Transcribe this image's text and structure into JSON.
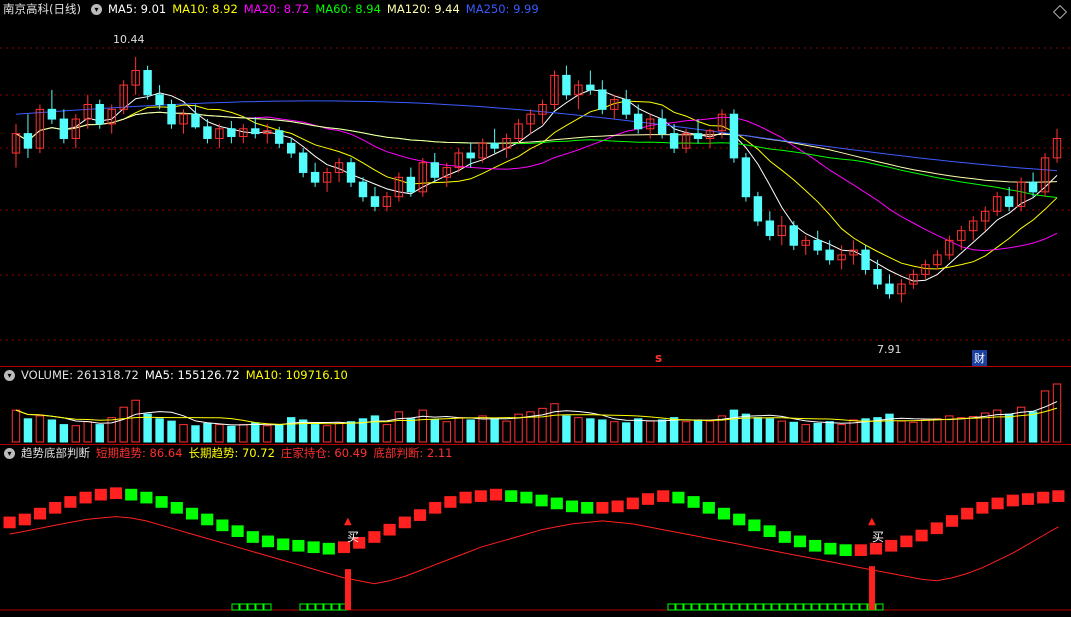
{
  "price_header": {
    "stock": "南京高科(日线)",
    "ma5": "MA5: 9.01",
    "ma10": "MA10: 8.92",
    "ma20": "MA20: 8.72",
    "ma60": "MA60: 8.94",
    "ma120": "MA120: 9.44",
    "ma250": "MA250: 9.99"
  },
  "price_annotations": {
    "high": "10.44",
    "low": "7.91",
    "marker_s": "s",
    "marker_cai": "财"
  },
  "volume_header": {
    "volume": "VOLUME: 261318.72",
    "ma5": "MA5: 155126.72",
    "ma10": "MA10: 109716.10"
  },
  "indicator_header": {
    "name": "趋势底部判断",
    "short": "短期趋势: 86.64",
    "long": "长期趋势: 70.72",
    "holding": "庄家持仓: 60.49",
    "bottom": "底部判断: 2.11"
  },
  "buy_signals": [
    {
      "label": "买"
    },
    {
      "label": "买"
    }
  ],
  "colors": {
    "bg": "#000000",
    "up": "#ff3232",
    "down": "#54fcfc",
    "ma5": "#ffffff",
    "ma10": "#ffff00",
    "ma20": "#ff00ff",
    "ma60": "#00ff00",
    "ma120": "#ffffb0",
    "ma250": "#3b5bff",
    "grid": "#8b0000",
    "ind_red": "#ff2020",
    "ind_green": "#00ff00"
  },
  "chart_data": {
    "type": "candlestick",
    "price_range": [
      7.4,
      10.8
    ],
    "candles": [
      [
        9.45,
        9.75,
        9.3,
        9.65
      ],
      [
        9.65,
        9.85,
        9.4,
        9.5
      ],
      [
        9.5,
        9.95,
        9.45,
        9.9
      ],
      [
        9.9,
        10.1,
        9.75,
        9.8
      ],
      [
        9.8,
        9.9,
        9.55,
        9.6
      ],
      [
        9.6,
        9.85,
        9.5,
        9.8
      ],
      [
        9.8,
        10.05,
        9.7,
        9.95
      ],
      [
        9.95,
        10.0,
        9.7,
        9.75
      ],
      [
        9.75,
        9.95,
        9.65,
        9.9
      ],
      [
        9.9,
        10.2,
        9.85,
        10.15
      ],
      [
        10.15,
        10.44,
        10.05,
        10.3
      ],
      [
        10.3,
        10.35,
        10.0,
        10.05
      ],
      [
        10.05,
        10.15,
        9.9,
        9.95
      ],
      [
        9.95,
        10.0,
        9.7,
        9.75
      ],
      [
        9.75,
        9.9,
        9.65,
        9.85
      ],
      [
        9.85,
        9.95,
        9.7,
        9.72
      ],
      [
        9.72,
        9.8,
        9.55,
        9.6
      ],
      [
        9.6,
        9.75,
        9.5,
        9.7
      ],
      [
        9.7,
        9.78,
        9.55,
        9.62
      ],
      [
        9.62,
        9.75,
        9.55,
        9.7
      ],
      [
        9.7,
        9.82,
        9.6,
        9.65
      ],
      [
        9.65,
        9.75,
        9.55,
        9.68
      ],
      [
        9.68,
        9.72,
        9.5,
        9.55
      ],
      [
        9.55,
        9.6,
        9.4,
        9.45
      ],
      [
        9.45,
        9.5,
        9.2,
        9.25
      ],
      [
        9.25,
        9.35,
        9.1,
        9.15
      ],
      [
        9.15,
        9.3,
        9.05,
        9.25
      ],
      [
        9.25,
        9.4,
        9.15,
        9.35
      ],
      [
        9.35,
        9.4,
        9.1,
        9.15
      ],
      [
        9.15,
        9.2,
        8.95,
        9.0
      ],
      [
        9.0,
        9.1,
        8.85,
        8.9
      ],
      [
        8.9,
        9.05,
        8.85,
        9.0
      ],
      [
        9.0,
        9.25,
        8.95,
        9.2
      ],
      [
        9.2,
        9.3,
        9.0,
        9.05
      ],
      [
        9.05,
        9.4,
        9.0,
        9.35
      ],
      [
        9.35,
        9.45,
        9.15,
        9.2
      ],
      [
        9.2,
        9.35,
        9.1,
        9.3
      ],
      [
        9.3,
        9.5,
        9.25,
        9.45
      ],
      [
        9.45,
        9.55,
        9.3,
        9.4
      ],
      [
        9.4,
        9.6,
        9.35,
        9.55
      ],
      [
        9.55,
        9.7,
        9.45,
        9.5
      ],
      [
        9.5,
        9.65,
        9.4,
        9.6
      ],
      [
        9.6,
        9.8,
        9.55,
        9.75
      ],
      [
        9.75,
        9.9,
        9.65,
        9.85
      ],
      [
        9.85,
        10.0,
        9.75,
        9.95
      ],
      [
        9.95,
        10.3,
        9.9,
        10.25
      ],
      [
        10.25,
        10.35,
        10.0,
        10.05
      ],
      [
        10.05,
        10.2,
        9.9,
        10.15
      ],
      [
        10.15,
        10.3,
        10.05,
        10.1
      ],
      [
        10.1,
        10.2,
        9.85,
        9.9
      ],
      [
        9.9,
        10.05,
        9.8,
        10.0
      ],
      [
        10.0,
        10.1,
        9.8,
        9.85
      ],
      [
        9.85,
        9.95,
        9.65,
        9.7
      ],
      [
        9.7,
        9.85,
        9.6,
        9.8
      ],
      [
        9.8,
        9.9,
        9.6,
        9.65
      ],
      [
        9.65,
        9.75,
        9.45,
        9.5
      ],
      [
        9.5,
        9.7,
        9.45,
        9.65
      ],
      [
        9.65,
        9.8,
        9.55,
        9.6
      ],
      [
        9.6,
        9.7,
        9.5,
        9.68
      ],
      [
        9.68,
        9.9,
        9.6,
        9.85
      ],
      [
        9.85,
        9.9,
        9.35,
        9.4
      ],
      [
        9.4,
        9.45,
        8.95,
        9.0
      ],
      [
        9.0,
        9.05,
        8.7,
        8.75
      ],
      [
        8.75,
        8.85,
        8.55,
        8.6
      ],
      [
        8.6,
        8.8,
        8.5,
        8.7
      ],
      [
        8.7,
        8.75,
        8.45,
        8.5
      ],
      [
        8.5,
        8.6,
        8.4,
        8.55
      ],
      [
        8.55,
        8.65,
        8.4,
        8.45
      ],
      [
        8.45,
        8.55,
        8.3,
        8.35
      ],
      [
        8.35,
        8.5,
        8.25,
        8.4
      ],
      [
        8.4,
        8.55,
        8.3,
        8.45
      ],
      [
        8.45,
        8.5,
        8.2,
        8.25
      ],
      [
        8.25,
        8.35,
        8.05,
        8.1
      ],
      [
        8.1,
        8.2,
        7.95,
        8.0
      ],
      [
        8.0,
        8.15,
        7.91,
        8.1
      ],
      [
        8.1,
        8.25,
        8.05,
        8.2
      ],
      [
        8.2,
        8.35,
        8.15,
        8.3
      ],
      [
        8.3,
        8.45,
        8.25,
        8.4
      ],
      [
        8.4,
        8.6,
        8.35,
        8.55
      ],
      [
        8.55,
        8.7,
        8.45,
        8.65
      ],
      [
        8.65,
        8.8,
        8.55,
        8.75
      ],
      [
        8.75,
        8.9,
        8.65,
        8.85
      ],
      [
        8.85,
        9.05,
        8.8,
        9.0
      ],
      [
        9.0,
        9.1,
        8.85,
        8.9
      ],
      [
        8.9,
        9.2,
        8.85,
        9.15
      ],
      [
        9.15,
        9.25,
        9.0,
        9.05
      ],
      [
        9.05,
        9.45,
        9.0,
        9.4
      ],
      [
        9.4,
        9.7,
        9.35,
        9.6
      ]
    ],
    "volumes": [
      55,
      40,
      45,
      38,
      30,
      28,
      35,
      30,
      42,
      60,
      72,
      48,
      40,
      36,
      30,
      28,
      32,
      30,
      27,
      30,
      33,
      28,
      30,
      42,
      38,
      30,
      28,
      32,
      35,
      40,
      45,
      30,
      52,
      40,
      55,
      38,
      35,
      42,
      38,
      45,
      40,
      36,
      48,
      52,
      58,
      66,
      45,
      42,
      40,
      38,
      35,
      33,
      40,
      36,
      38,
      42,
      35,
      38,
      36,
      45,
      55,
      48,
      42,
      40,
      36,
      34,
      30,
      32,
      35,
      30,
      38,
      40,
      42,
      48,
      36,
      34,
      38,
      40,
      45,
      42,
      44,
      50,
      55,
      48,
      60,
      52,
      88,
      100
    ],
    "indicator_short_trend": [
      60,
      62,
      66,
      70,
      74,
      77,
      79,
      80,
      79,
      77,
      74,
      70,
      66,
      62,
      58,
      54,
      50,
      47,
      45,
      44,
      43,
      42,
      43,
      46,
      50,
      55,
      60,
      65,
      70,
      74,
      77,
      78,
      79,
      78,
      77,
      75,
      73,
      71,
      70,
      70,
      71,
      73,
      76,
      78,
      77,
      74,
      70,
      66,
      62,
      58,
      54,
      50,
      47,
      44,
      42,
      41,
      41,
      42,
      44,
      47,
      51,
      56,
      61,
      66,
      70,
      73,
      75,
      76,
      77,
      78
    ],
    "indicator_long_trend": [
      52,
      54,
      56,
      58,
      60,
      62,
      63,
      64,
      63,
      61,
      58,
      55,
      52,
      49,
      46,
      43,
      40,
      37,
      34,
      31,
      28,
      25,
      22,
      20,
      18,
      20,
      23,
      27,
      31,
      35,
      39,
      43,
      46,
      49,
      52,
      55,
      57,
      59,
      60,
      61,
      60,
      59,
      57,
      55,
      53,
      51,
      49,
      47,
      45,
      43,
      41,
      39,
      37,
      35,
      33,
      31,
      29,
      27,
      25,
      23,
      21,
      20,
      22,
      25,
      29,
      34,
      39,
      45,
      51,
      57
    ]
  }
}
